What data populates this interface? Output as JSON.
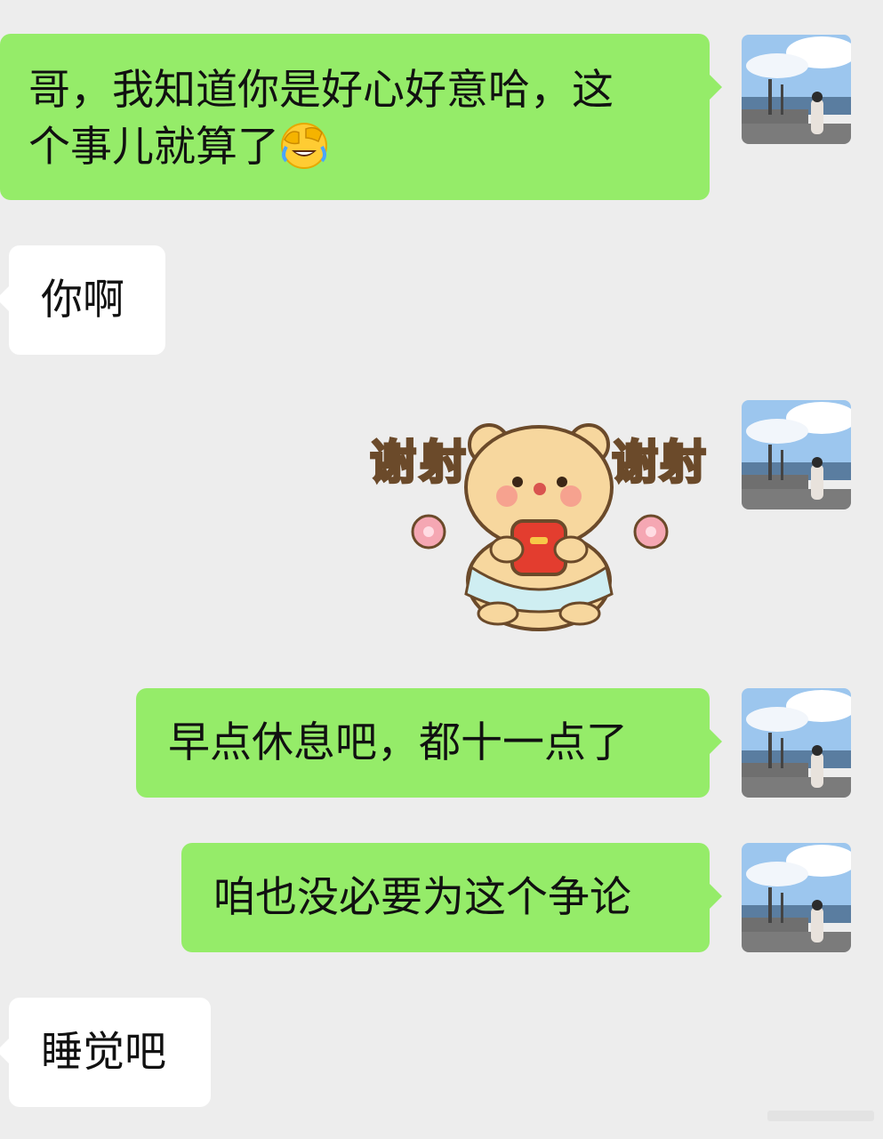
{
  "messages": [
    {
      "sender": "me",
      "type": "text",
      "line1": "哥，我知道你是好心好意哈，这",
      "line2": "个事儿就算了",
      "emoji": "face-palm-tears-emoji"
    },
    {
      "sender": "other",
      "type": "text",
      "text": "你啊"
    },
    {
      "sender": "me",
      "type": "sticker",
      "sticker": "bear-thanks-sticker",
      "sticker_text_left": "谢",
      "sticker_text_right": "谢"
    },
    {
      "sender": "me",
      "type": "text",
      "text": "早点休息吧，都十一点了"
    },
    {
      "sender": "me",
      "type": "text",
      "text": "咱也没必要为这个争论"
    },
    {
      "sender": "other",
      "type": "text",
      "text": "睡觉吧"
    }
  ],
  "avatar": {
    "icon": "user-avatar-photo"
  },
  "colors": {
    "background": "#ededed",
    "my_bubble": "#95ec69",
    "their_bubble": "#ffffff"
  }
}
